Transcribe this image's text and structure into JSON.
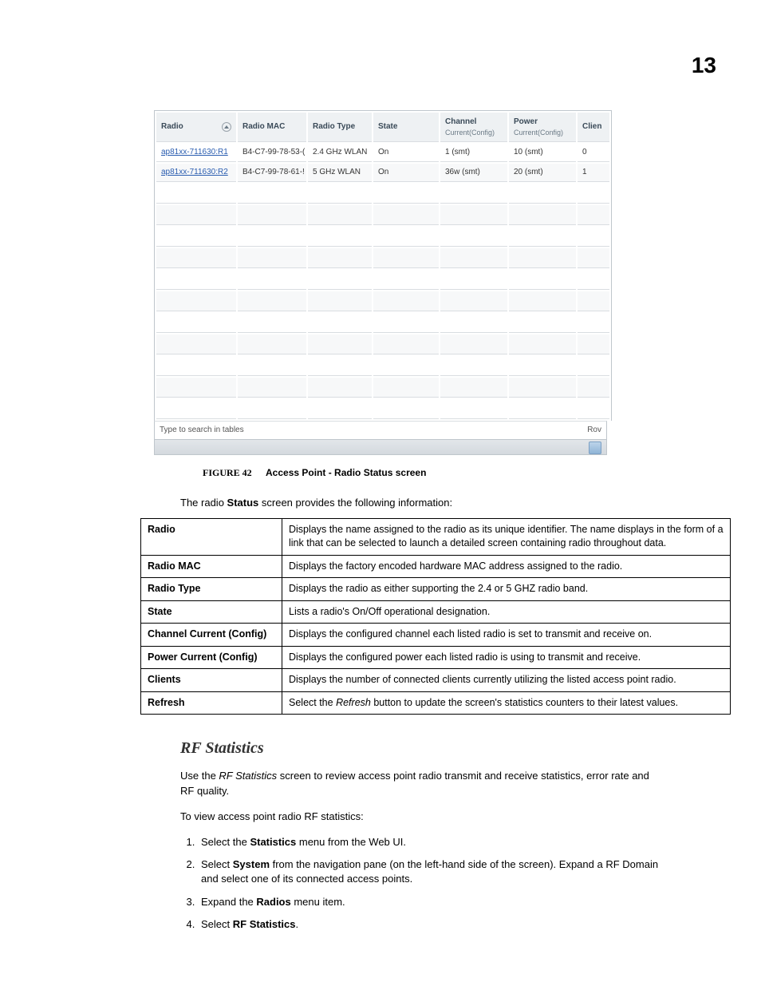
{
  "page": {
    "number": "13"
  },
  "screenshot": {
    "headers": {
      "radio": "Radio",
      "radioMAC": "Radio MAC",
      "radioType": "Radio Type",
      "state": "State",
      "channel": "Channel",
      "channelSub": "Current(Config)",
      "power": "Power",
      "powerSub": "Current(Config)",
      "clients": "Clien"
    },
    "rows": [
      {
        "radio": "ap81xx-711630:R1",
        "mac": "B4-C7-99-78-53-(",
        "type": "2.4 GHz WLAN",
        "state": "On",
        "channel": "1 (smt)",
        "power": "10 (smt)",
        "clients": "0"
      },
      {
        "radio": "ap81xx-711630:R2",
        "mac": "B4-C7-99-78-61-!",
        "type": "5 GHz WLAN",
        "state": "On",
        "channel": "36w (smt)",
        "power": "20 (smt)",
        "clients": "1"
      }
    ],
    "footer": {
      "search": "Type to search in tables",
      "row": "Rov"
    }
  },
  "figure": {
    "label": "FIGURE 42",
    "caption": "Access Point - Radio Status screen"
  },
  "intro": {
    "pre": "The radio ",
    "bold": "Status",
    "post": " screen provides the following information:"
  },
  "defs": [
    {
      "term": "Radio",
      "desc": "Displays the name assigned to the radio as its unique identifier. The name displays in the form of a link that can be selected to launch a detailed screen containing radio throughout data."
    },
    {
      "term": "Radio MAC",
      "desc": "Displays the factory encoded hardware MAC address assigned to the radio."
    },
    {
      "term": "Radio Type",
      "desc": "Displays the radio as either supporting the 2.4 or 5 GHZ radio band."
    },
    {
      "term": "State",
      "desc": "Lists a radio's On/Off operational designation."
    },
    {
      "term": "Channel Current (Config)",
      "desc": "Displays the configured channel each listed radio is set to transmit and receive on."
    },
    {
      "term": "Power Current (Config)",
      "desc": "Displays the configured power each listed radio is using to transmit and receive."
    },
    {
      "term": "Clients",
      "desc": "Displays the number of connected clients currently utilizing the listed access point radio."
    },
    {
      "term": "Refresh",
      "desc_pre": "Select the ",
      "desc_italic": "Refresh",
      "desc_post": " button to update the screen's statistics counters to their latest values."
    }
  ],
  "section": {
    "heading": "RF Statistics",
    "para1_pre": "Use the ",
    "para1_italic": "RF Statistics",
    "para1_post": " screen to review access point radio transmit and receive statistics, error rate and RF quality.",
    "para2": "To view access point radio RF statistics:"
  },
  "steps": [
    {
      "pre": "Select the ",
      "bold": "Statistics",
      "post": " menu from the Web UI."
    },
    {
      "pre": "Select ",
      "bold": "System",
      "post": " from the navigation pane (on the left-hand side of the screen). Expand a RF Domain and select one of its connected access points."
    },
    {
      "pre": "Expand the ",
      "bold": "Radios",
      "post": " menu item."
    },
    {
      "pre": "Select ",
      "bold": "RF Statistics",
      "post": "."
    }
  ]
}
